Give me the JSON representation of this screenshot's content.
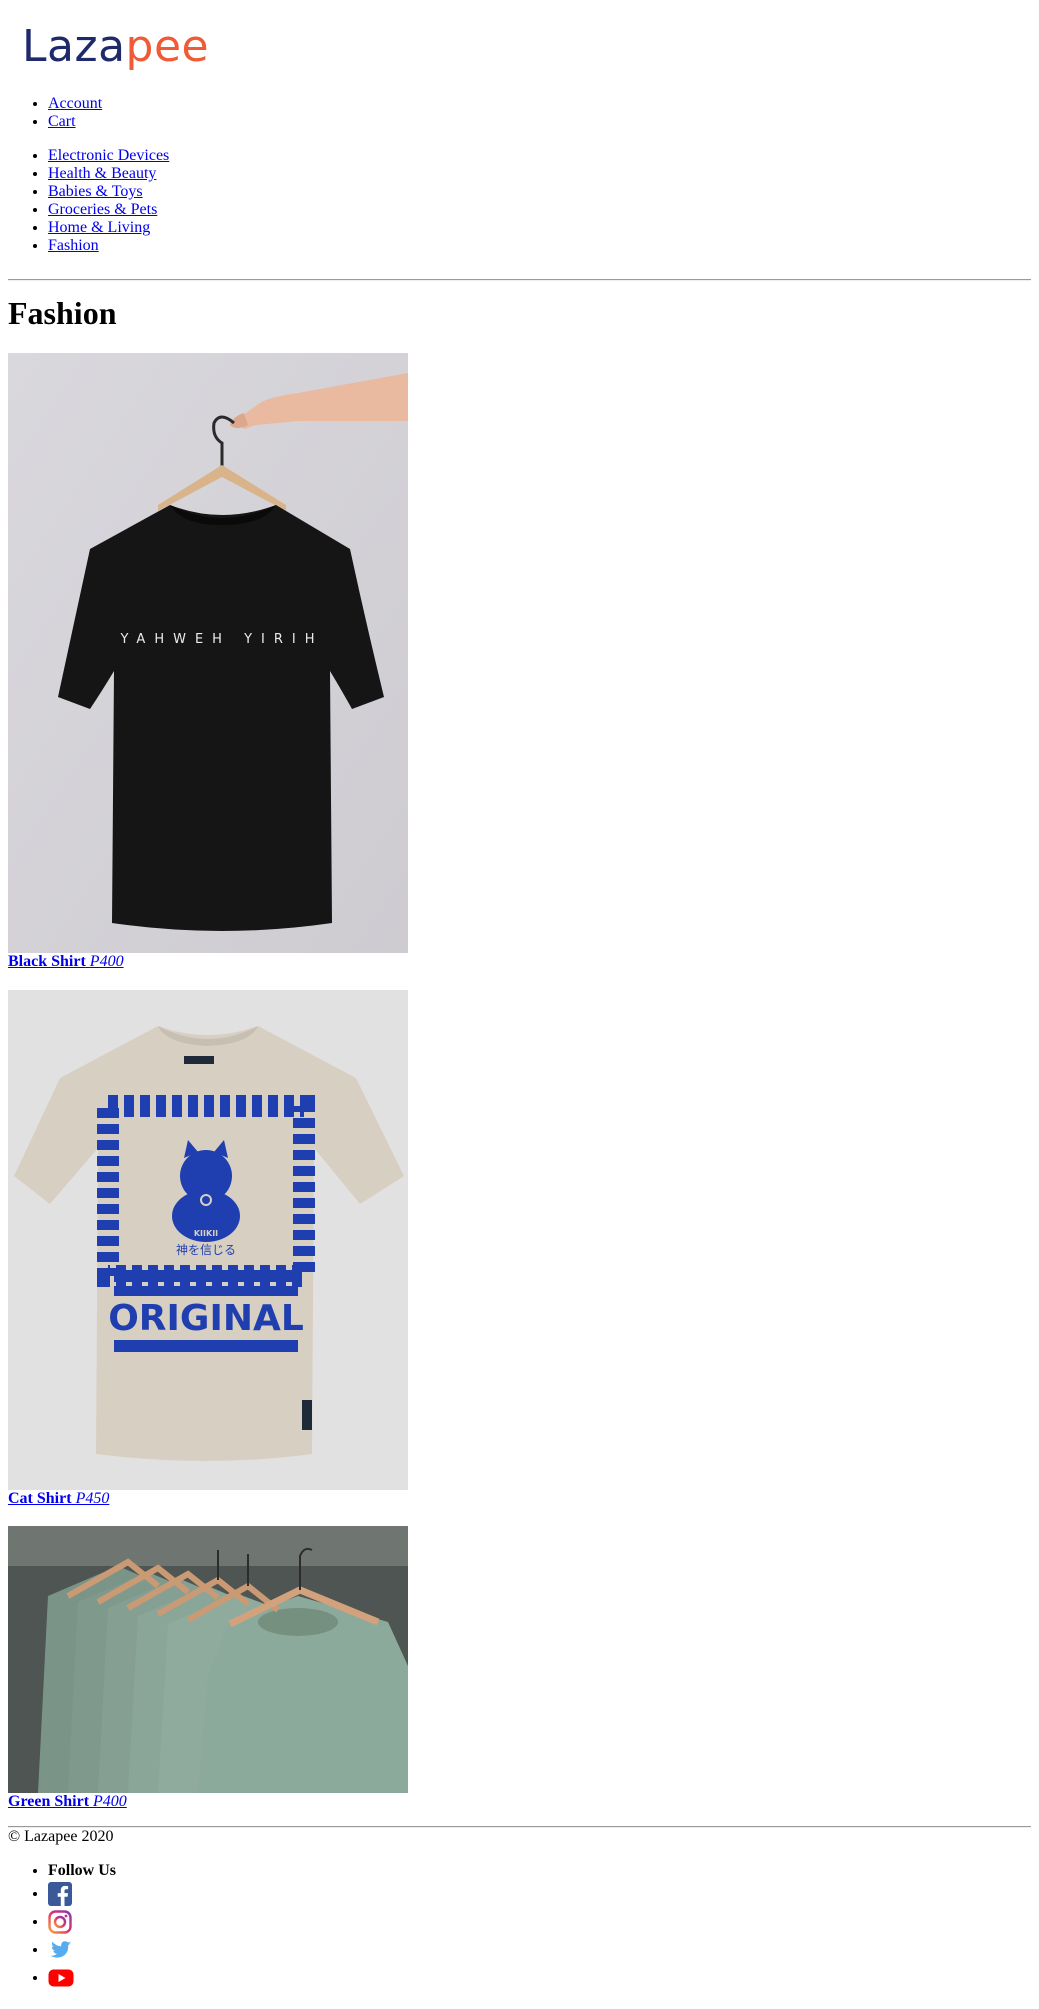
{
  "logo": {
    "part1": "Laza",
    "part2": "pee",
    "color1": "#1f2a6b",
    "color2": "#f05a36"
  },
  "account_nav": {
    "items": [
      {
        "label": "Account"
      },
      {
        "label": "Cart"
      }
    ]
  },
  "category_nav": {
    "items": [
      {
        "label": "Electronic Devices"
      },
      {
        "label": "Health & Beauty"
      },
      {
        "label": "Babies & Toys"
      },
      {
        "label": "Groceries & Pets"
      },
      {
        "label": "Home & Living"
      },
      {
        "label": "Fashion"
      }
    ]
  },
  "page_title": "Fashion",
  "products": [
    {
      "name": "Black Shirt",
      "price": "P400",
      "print_text": "YAHWEH YIRIH"
    },
    {
      "name": "Cat Shirt",
      "price": "P450",
      "print_text": "ORIGINAL",
      "print_subtext": "神を信じる",
      "brand_text": "KIIKII"
    },
    {
      "name": "Green Shirt",
      "price": "P400"
    }
  ],
  "footer": {
    "copyright": "© Lazapee 2020",
    "follow_label": "Follow Us",
    "social": [
      {
        "icon": "facebook-icon",
        "color": "#3b5998"
      },
      {
        "icon": "instagram-icon",
        "color": "#c13584"
      },
      {
        "icon": "twitter-icon",
        "color": "#55acee"
      },
      {
        "icon": "youtube-icon",
        "color": "#ff0000"
      }
    ]
  }
}
